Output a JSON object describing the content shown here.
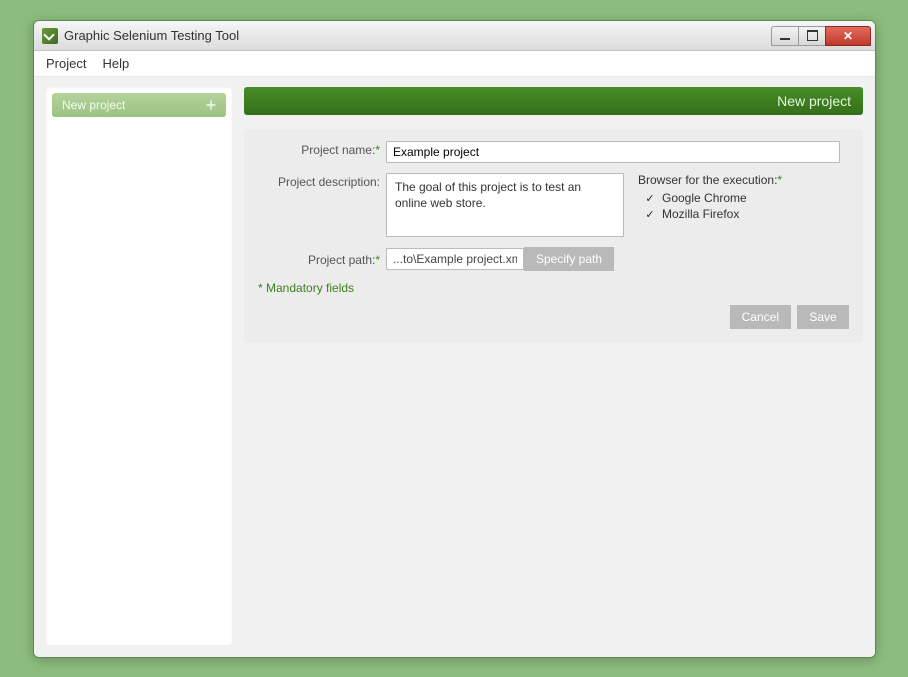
{
  "window": {
    "title": "Graphic Selenium Testing Tool"
  },
  "menu": {
    "project": "Project",
    "help": "Help"
  },
  "sidebar": {
    "new_project_chip": "New project"
  },
  "panel": {
    "header": "New project"
  },
  "form": {
    "labels": {
      "project_name": "Project name:",
      "project_description": "Project description:",
      "project_path": "Project path:",
      "browser_header": "Browser for the execution:"
    },
    "values": {
      "project_name": "Example project",
      "project_description": "The goal of this project is to test an online web store.",
      "project_path": "...to\\Example project.xml"
    },
    "browsers": {
      "chrome": "Google Chrome",
      "firefox": "Mozilla Firefox"
    },
    "buttons": {
      "specify_path": "Specify path",
      "cancel": "Cancel",
      "save": "Save"
    },
    "mandatory_note": "* Mandatory fields",
    "asterisk": "*"
  }
}
